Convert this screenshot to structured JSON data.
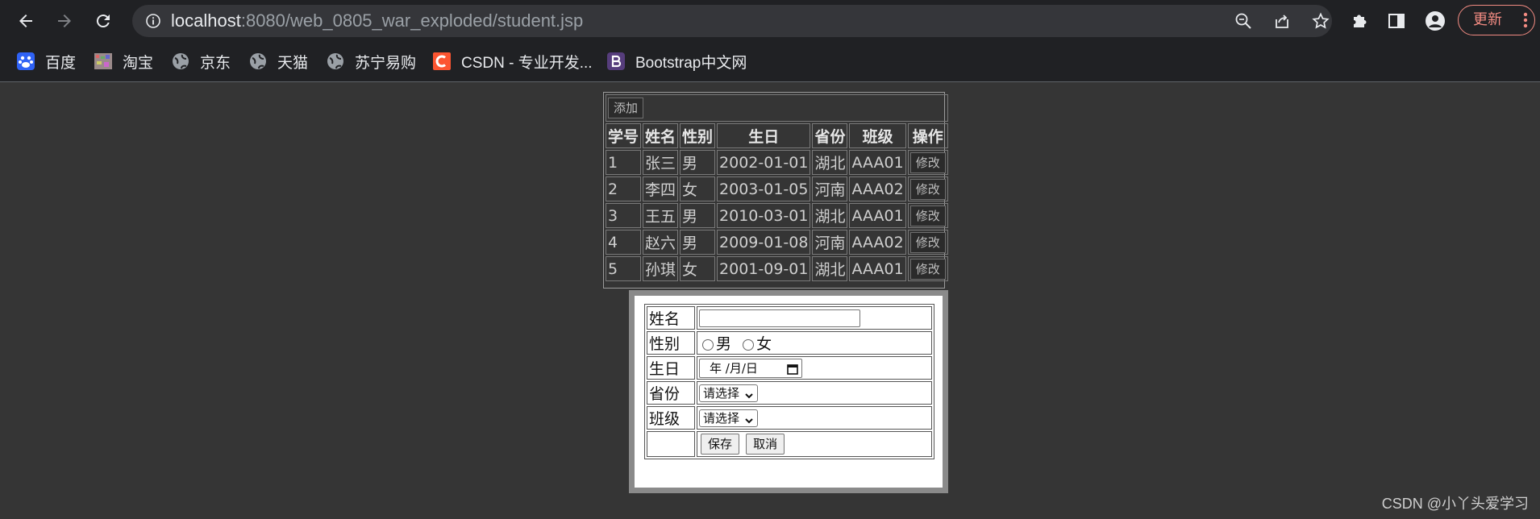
{
  "browser": {
    "url_host": "localhost",
    "url_path": ":8080/web_0805_war_exploded/student.jsp",
    "update_label": "更新",
    "bookmarks": [
      {
        "label": "百度",
        "icon": "baidu-icon"
      },
      {
        "label": "淘宝",
        "icon": "taobao-icon"
      },
      {
        "label": "京东",
        "icon": "globe-icon"
      },
      {
        "label": "天猫",
        "icon": "globe-icon"
      },
      {
        "label": "苏宁易购",
        "icon": "globe-icon"
      },
      {
        "label": "CSDN - 专业开发...",
        "icon": "csdn-icon"
      },
      {
        "label": "Bootstrap中文网",
        "icon": "bootstrap-icon"
      }
    ]
  },
  "student_table": {
    "add_label": "添加",
    "headers": [
      "学号",
      "姓名",
      "性别",
      "生日",
      "省份",
      "班级",
      "操作"
    ],
    "edit_label": "修改",
    "rows": [
      [
        "1",
        "张三",
        "男",
        "2002-01-01",
        "湖北",
        "AAA01"
      ],
      [
        "2",
        "李四",
        "女",
        "2003-01-05",
        "河南",
        "AAA02"
      ],
      [
        "3",
        "王五",
        "男",
        "2010-03-01",
        "湖北",
        "AAA01"
      ],
      [
        "4",
        "赵六",
        "男",
        "2009-01-08",
        "河南",
        "AAA02"
      ],
      [
        "5",
        "孙琪",
        "女",
        "2001-09-01",
        "湖北",
        "AAA01"
      ]
    ]
  },
  "form": {
    "name_label": "姓名",
    "name_value": "",
    "gender_label": "性别",
    "gender_male": "男",
    "gender_female": "女",
    "birthday_label": "生日",
    "birthday_placeholder": "年 /月/日",
    "province_label": "省份",
    "province_selected": "请选择",
    "class_label": "班级",
    "class_selected": "请选择",
    "save_label": "保存",
    "cancel_label": "取消"
  },
  "watermark": "CSDN @小丫头爱学习",
  "colors": {
    "chrome_bg": "#202124",
    "page_bg": "#353535",
    "update_accent": "#f28b82"
  }
}
